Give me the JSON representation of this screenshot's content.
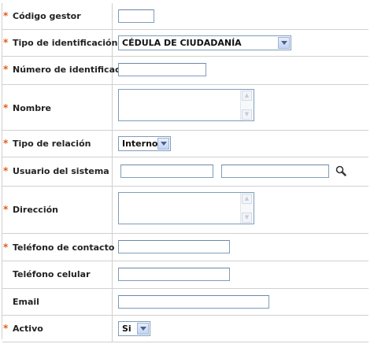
{
  "form": {
    "codigo_gestor": {
      "label": "Código gestor",
      "required_mark": "*",
      "value": ""
    },
    "tipo_identificacion": {
      "label": "Tipo de identificación",
      "required_mark": "*",
      "selected": "CÉDULA DE CIUDADANÍA"
    },
    "numero_identificacion": {
      "label": "Número de identificación",
      "required_mark": "*",
      "value": ""
    },
    "nombre": {
      "label": "Nombre",
      "required_mark": "*",
      "value": ""
    },
    "tipo_relacion": {
      "label": "Tipo de relación",
      "required_mark": "*",
      "selected": "Interno"
    },
    "usuario_sistema": {
      "label": "Usuario del sistema",
      "required_mark": "*",
      "value_1": "",
      "value_2": "",
      "search_icon": "magnifier-icon"
    },
    "direccion": {
      "label": "Dirección",
      "required_mark": "*",
      "value": ""
    },
    "telefono_contacto": {
      "label": "Teléfono de contacto",
      "required_mark": "*",
      "value": ""
    },
    "telefono_celular": {
      "label": "Teléfono celular",
      "value": ""
    },
    "email": {
      "label": "Email",
      "value": ""
    },
    "activo": {
      "label": "Activo",
      "required_mark": "*",
      "selected": "Si"
    }
  },
  "colors": {
    "required_mark": "#e25b14",
    "field_border": "#7f9db9",
    "grid_line": "#d0d0d0"
  }
}
